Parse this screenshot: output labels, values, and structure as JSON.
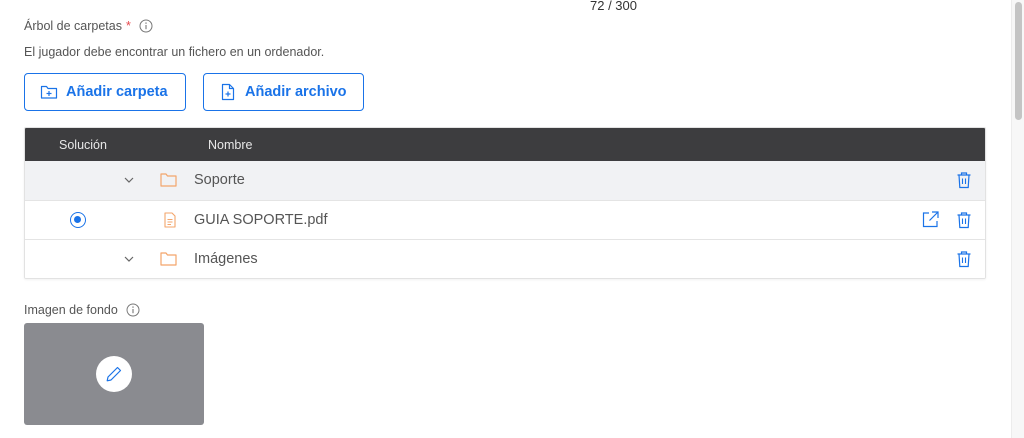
{
  "char_counter": "72 / 300",
  "folder_tree": {
    "label": "Árbol de carpetas",
    "required_mark": "*",
    "description": "El jugador debe encontrar un fichero en un ordenador.",
    "add_folder_label": "Añadir carpeta",
    "add_file_label": "Añadir archivo",
    "columns": {
      "solution": "Solución",
      "name": "Nombre"
    },
    "rows": [
      {
        "name": "Soporte",
        "type": "folder",
        "expanded": true,
        "selected_solution": false
      },
      {
        "name": "GUIA SOPORTE.pdf",
        "type": "pdf",
        "selected_solution": true
      },
      {
        "name": "Imágenes",
        "type": "folder",
        "expanded": true,
        "selected_solution": false
      }
    ]
  },
  "background_image": {
    "label": "Imagen de fondo"
  },
  "colors": {
    "accent": "#1a73e8",
    "header_bg": "#3d3d3f",
    "folder_icon": "#f3a56b",
    "image_placeholder": "#8a8b90"
  },
  "icons": [
    "info-icon",
    "folder-plus-icon",
    "file-plus-icon",
    "chevron-down-icon",
    "folder-icon",
    "pdf-file-icon",
    "external-link-icon",
    "trash-icon",
    "pencil-icon"
  ]
}
